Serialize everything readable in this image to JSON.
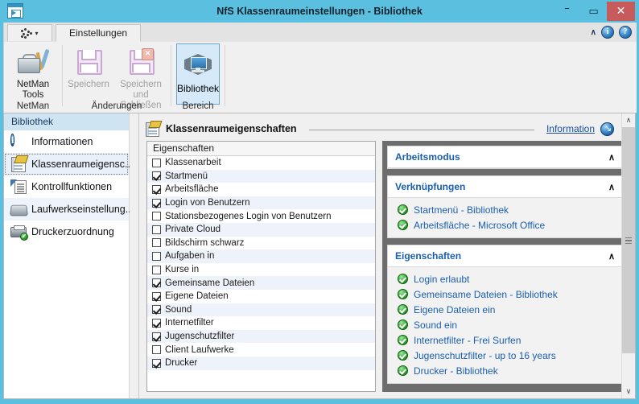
{
  "window": {
    "title": "NfS Klassenraumeinstellungen - Bibliothek",
    "app_icon": "window-app-icon",
    "minimize": "–",
    "maximize": "▭",
    "close": "✕"
  },
  "ribbon": {
    "quick_access_icon": "dots-icon",
    "quick_access_chevron": "▾",
    "collapse_chevron": "∧",
    "info_icon_label": "i",
    "help_icon_label": "?",
    "tabs": [
      {
        "label": "Einstellungen",
        "active": true
      }
    ],
    "groups": [
      {
        "label": "NetMan",
        "items": [
          {
            "label": "NetMan\nTools",
            "label_line1": "NetMan",
            "label_line2": "Tools",
            "icon": "toolbox-icon",
            "enabled": true
          }
        ]
      },
      {
        "label": "Änderungen",
        "items": [
          {
            "label_line1": "Speichern",
            "label_line2": "",
            "icon": "floppy-save-icon",
            "enabled": false
          },
          {
            "label_line1": "Speichern",
            "label_line2": "und Schließen",
            "icon": "floppy-save-close-icon",
            "enabled": false
          }
        ]
      },
      {
        "label": "Bereich",
        "items": [
          {
            "label_line1": "Bibliothek",
            "label_line2": "",
            "icon": "monitor-icon",
            "enabled": true,
            "selected": true
          }
        ]
      }
    ]
  },
  "sidebar": {
    "header": "Bibliothek",
    "items": [
      {
        "label": "Informationen",
        "icon": "info-circle-icon",
        "selected": false
      },
      {
        "label": "Klassenraumeigensc...",
        "icon": "document-pencil-icon",
        "selected": true
      },
      {
        "label": "Kontrollfunktionen",
        "icon": "cursor-list-icon",
        "selected": false
      },
      {
        "label": "Laufwerkseinstellung...",
        "icon": "drive-icon",
        "selected": false,
        "hover": true
      },
      {
        "label": "Druckerzuordnung",
        "icon": "printer-check-icon",
        "selected": false
      }
    ]
  },
  "main": {
    "title": "Klassenraumeigenschaften",
    "title_icon": "document-pencil-icon",
    "info_link": "Information",
    "info_badge_icon": "info-arrow-icon",
    "listbox": {
      "header": "Eigenschaften",
      "rows": [
        {
          "label": "Klassenarbeit",
          "checked": false
        },
        {
          "label": "Startmenü",
          "checked": true
        },
        {
          "label": "Arbeitsfläche",
          "checked": true
        },
        {
          "label": "Login von Benutzern",
          "checked": true
        },
        {
          "label": "Stationsbezogenes Login von Benutzern",
          "checked": false
        },
        {
          "label": "Private Cloud",
          "checked": false
        },
        {
          "label": "Bildschirm schwarz",
          "checked": false
        },
        {
          "label": "Aufgaben in",
          "checked": false
        },
        {
          "label": "Kurse in",
          "checked": false
        },
        {
          "label": "Gemeinsame Dateien",
          "checked": true
        },
        {
          "label": "Eigene Dateien",
          "checked": true
        },
        {
          "label": "Sound",
          "checked": true
        },
        {
          "label": "Internetfilter",
          "checked": true
        },
        {
          "label": "Jugenschutzfilter",
          "checked": true
        },
        {
          "label": "Client Laufwerke",
          "checked": false
        },
        {
          "label": "Drucker",
          "checked": true
        }
      ]
    },
    "panels": [
      {
        "title": "Arbeitsmodus",
        "chevron": "∧",
        "rows": []
      },
      {
        "title": "Verknüpfungen",
        "chevron": "∧",
        "rows": [
          {
            "label": "Startmenü - Bibliothek",
            "icon": "green-check-icon"
          },
          {
            "label": "Arbeitsfläche - Microsoft Office",
            "icon": "green-check-icon"
          }
        ]
      },
      {
        "title": "Eigenschaften",
        "chevron": "∧",
        "rows": [
          {
            "label": "Login erlaubt",
            "icon": "green-check-icon"
          },
          {
            "label": "Gemeinsame Dateien - Bibliothek",
            "icon": "green-check-icon"
          },
          {
            "label": "Eigene Dateien ein",
            "icon": "green-check-icon"
          },
          {
            "label": "Sound ein",
            "icon": "green-check-icon"
          },
          {
            "label": "Internetfilter - Frei Surfen",
            "icon": "green-check-icon"
          },
          {
            "label": "Jugenschutzfilter - up to 16 years",
            "icon": "green-check-icon"
          },
          {
            "label": "Drucker - Bibliothek",
            "icon": "green-check-icon"
          }
        ]
      }
    ]
  },
  "scrollbar": {
    "up_arrow": "∧",
    "down_arrow": "∨"
  },
  "colors": {
    "title_bar": "#5bbfe0",
    "close_button": "#c75b5b",
    "accent_link": "#1a5fae",
    "status_ok": "#2a9c2a",
    "panel_backdrop": "#6d6d6d"
  }
}
